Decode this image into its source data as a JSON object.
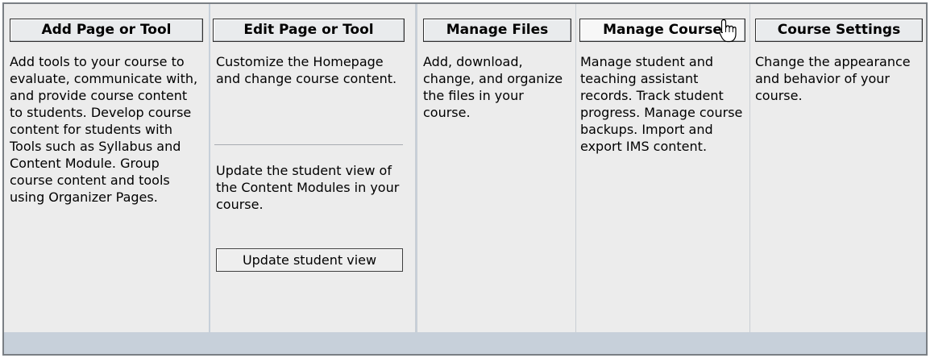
{
  "panels": [
    {
      "button": "Add Page or Tool",
      "description": "Add tools to your course to evaluate, communicate with, and provide course content to students. Develop course content for students with Tools such as Syllabus and Content Module. Group course content and tools using Organizer Pages."
    },
    {
      "button": "Edit Page or Tool",
      "description": "Customize the Homepage and change course content.",
      "secondary_description": "Update the student view of the Content Modules in your course.",
      "secondary_button": "Update student view"
    },
    {
      "button": "Manage Files",
      "description": "Add, download, change, and organize the files in your course."
    },
    {
      "button": "Manage Course",
      "description": "Manage student and teaching assistant records. Track student progress. Manage course backups. Import and export IMS content."
    },
    {
      "button": "Course Settings",
      "description": "Change the appearance and behavior of your course."
    }
  ],
  "cursor": "hand-pointer-icon",
  "colors": {
    "panel_bg": "#ececec",
    "frame_bg": "#c7d0da",
    "border": "#7a7f84"
  }
}
